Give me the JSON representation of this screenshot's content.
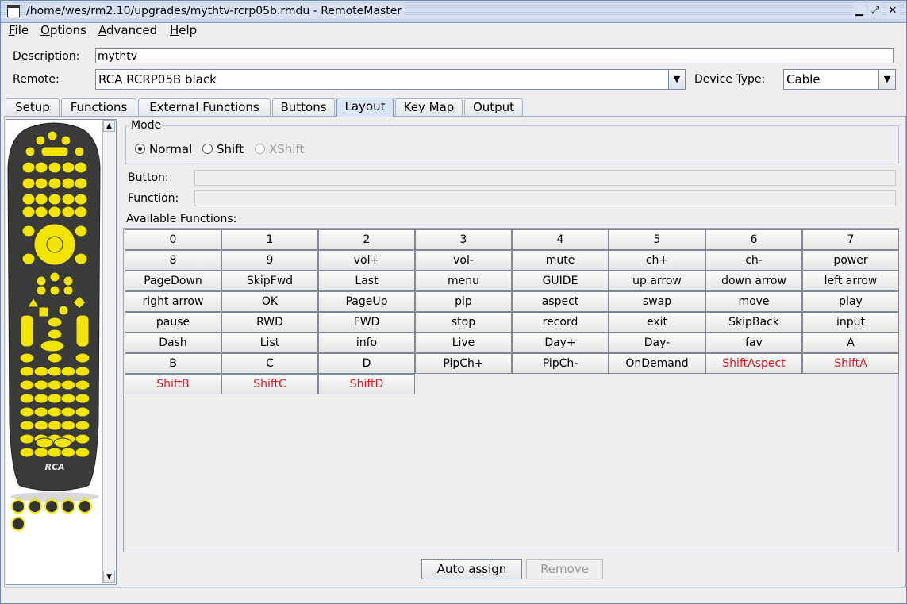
{
  "window": {
    "title": "/home/wes/rm2.10/upgrades/mythtv-rcrp05b.rmdu - RemoteMaster",
    "icons": [
      "app-icon",
      "minimize-icon",
      "maximize-icon",
      "close-icon"
    ]
  },
  "menubar": [
    {
      "label": "File",
      "mnemonic": "F",
      "rest": "ile"
    },
    {
      "label": "Options",
      "mnemonic": "O",
      "rest": "ptions"
    },
    {
      "label": "Advanced",
      "mnemonic": "A",
      "rest": "dvanced"
    },
    {
      "label": "Help",
      "mnemonic": "H",
      "rest": "elp"
    }
  ],
  "form": {
    "description_label": "Description:",
    "description_value": "mythtv",
    "remote_label": "Remote:",
    "remote_value": "RCA RCRP05B black",
    "device_type_label": "Device Type:",
    "device_type_value": "Cable"
  },
  "tabs": [
    {
      "label": "Setup",
      "active": false
    },
    {
      "label": "Functions",
      "active": false
    },
    {
      "label": "External Functions",
      "active": false
    },
    {
      "label": "Buttons",
      "active": false
    },
    {
      "label": "Layout",
      "active": true
    },
    {
      "label": "Key Map",
      "active": false
    },
    {
      "label": "Output",
      "active": false
    }
  ],
  "layout": {
    "remote_brand": "RCA",
    "mode_title": "Mode",
    "modes": [
      {
        "label": "Normal",
        "selected": true,
        "enabled": true
      },
      {
        "label": "Shift",
        "selected": false,
        "enabled": true
      },
      {
        "label": "XShift",
        "selected": false,
        "enabled": false
      }
    ],
    "button_label": "Button:",
    "button_value": "",
    "function_label": "Function:",
    "function_value": "",
    "available_label": "Available Functions:",
    "functions": [
      {
        "label": "0",
        "shifted": false
      },
      {
        "label": "1",
        "shifted": false
      },
      {
        "label": "2",
        "shifted": false
      },
      {
        "label": "3",
        "shifted": false
      },
      {
        "label": "4",
        "shifted": false
      },
      {
        "label": "5",
        "shifted": false
      },
      {
        "label": "6",
        "shifted": false
      },
      {
        "label": "7",
        "shifted": false
      },
      {
        "label": "8",
        "shifted": false
      },
      {
        "label": "9",
        "shifted": false
      },
      {
        "label": "vol+",
        "shifted": false
      },
      {
        "label": "vol-",
        "shifted": false
      },
      {
        "label": "mute",
        "shifted": false
      },
      {
        "label": "ch+",
        "shifted": false
      },
      {
        "label": "ch-",
        "shifted": false
      },
      {
        "label": "power",
        "shifted": false
      },
      {
        "label": "PageDown",
        "shifted": false
      },
      {
        "label": "SkipFwd",
        "shifted": false
      },
      {
        "label": "Last",
        "shifted": false
      },
      {
        "label": "menu",
        "shifted": false
      },
      {
        "label": "GUIDE",
        "shifted": false
      },
      {
        "label": "up arrow",
        "shifted": false
      },
      {
        "label": "down arrow",
        "shifted": false
      },
      {
        "label": "left arrow",
        "shifted": false
      },
      {
        "label": "right arrow",
        "shifted": false
      },
      {
        "label": "OK",
        "shifted": false
      },
      {
        "label": "PageUp",
        "shifted": false
      },
      {
        "label": "pip",
        "shifted": false
      },
      {
        "label": "aspect",
        "shifted": false
      },
      {
        "label": "swap",
        "shifted": false
      },
      {
        "label": "move",
        "shifted": false
      },
      {
        "label": "play",
        "shifted": false
      },
      {
        "label": "pause",
        "shifted": false
      },
      {
        "label": "RWD",
        "shifted": false
      },
      {
        "label": "FWD",
        "shifted": false
      },
      {
        "label": "stop",
        "shifted": false
      },
      {
        "label": "record",
        "shifted": false
      },
      {
        "label": "exit",
        "shifted": false
      },
      {
        "label": "SkipBack",
        "shifted": false
      },
      {
        "label": "input",
        "shifted": false
      },
      {
        "label": "Dash",
        "shifted": false
      },
      {
        "label": "List",
        "shifted": false
      },
      {
        "label": "info",
        "shifted": false
      },
      {
        "label": "Live",
        "shifted": false
      },
      {
        "label": "Day+",
        "shifted": false
      },
      {
        "label": "Day-",
        "shifted": false
      },
      {
        "label": "fav",
        "shifted": false
      },
      {
        "label": "A",
        "shifted": false
      },
      {
        "label": "B",
        "shifted": false
      },
      {
        "label": "C",
        "shifted": false
      },
      {
        "label": "D",
        "shifted": false
      },
      {
        "label": "PipCh+",
        "shifted": false
      },
      {
        "label": "PipCh-",
        "shifted": false
      },
      {
        "label": "OnDemand",
        "shifted": false
      },
      {
        "label": "ShiftAspect",
        "shifted": true
      },
      {
        "label": "ShiftA",
        "shifted": true
      },
      {
        "label": "ShiftB",
        "shifted": true
      },
      {
        "label": "ShiftC",
        "shifted": true
      },
      {
        "label": "ShiftD",
        "shifted": true
      }
    ],
    "auto_assign_label": "Auto assign",
    "remove_label": "Remove"
  },
  "colors": {
    "remote_body": "#3a3a3a",
    "remote_key": "#f0e400",
    "shifted_text": "#e0141e"
  }
}
